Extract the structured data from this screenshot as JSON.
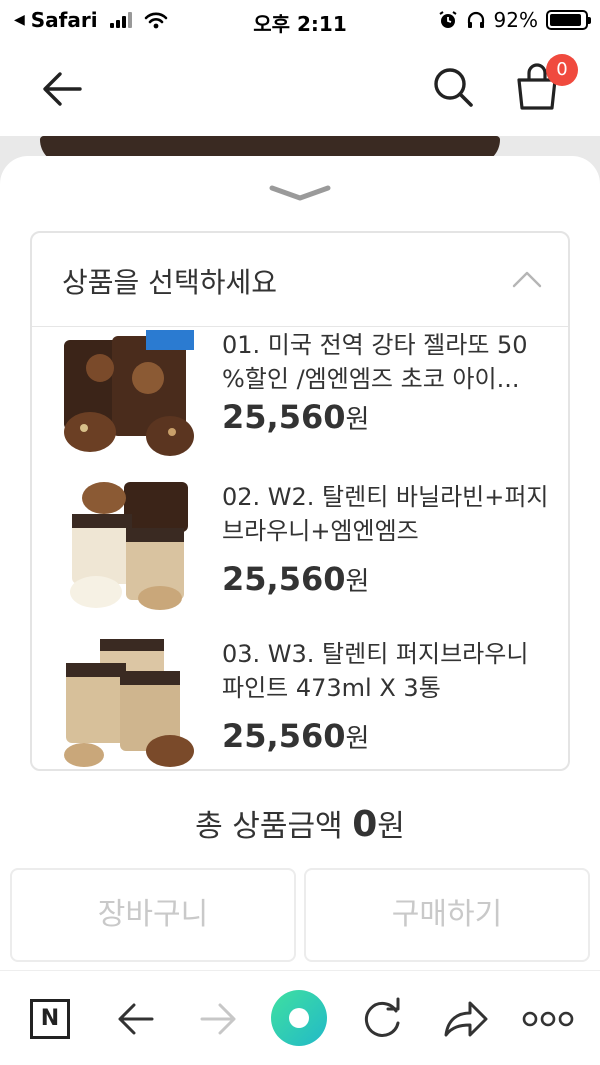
{
  "status_bar": {
    "back_app": "Safari",
    "time": "오후 2:11",
    "battery": "92%",
    "battery_level": 0.92
  },
  "header": {
    "back_icon": "arrow-left-icon",
    "search_icon": "search-icon",
    "cart_icon": "shopping-bag-icon",
    "cart_count": "0",
    "badge_color": "#f04a3e"
  },
  "option_select": {
    "placeholder": "상품을 선택하세요",
    "options": [
      {
        "name": "01. 미국 전역 강타 젤라또 50 %할인 /엠엔엠즈 초코 아이...",
        "price": "25,560",
        "unit": "원"
      },
      {
        "name": "02. W2. 탈렌티 바닐라빈+퍼지브라우니+엠엔엠즈",
        "price": "25,560",
        "unit": "원"
      },
      {
        "name": "03. W3. 탈렌티 퍼지브라우니 파인트 473ml X 3통",
        "price": "25,560",
        "unit": "원"
      }
    ]
  },
  "total": {
    "label": "총 상품금액",
    "amount": "0",
    "unit": "원"
  },
  "buttons": {
    "cart": "장바구니",
    "buy": "구매하기"
  },
  "browser_toolbar": {
    "icons": [
      "naver-n-icon",
      "back-arrow-icon",
      "forward-arrow-icon",
      "home-circle-icon",
      "reload-icon",
      "share-icon",
      "more-icon"
    ],
    "n_label": "N",
    "accent": "#2fd49a"
  }
}
